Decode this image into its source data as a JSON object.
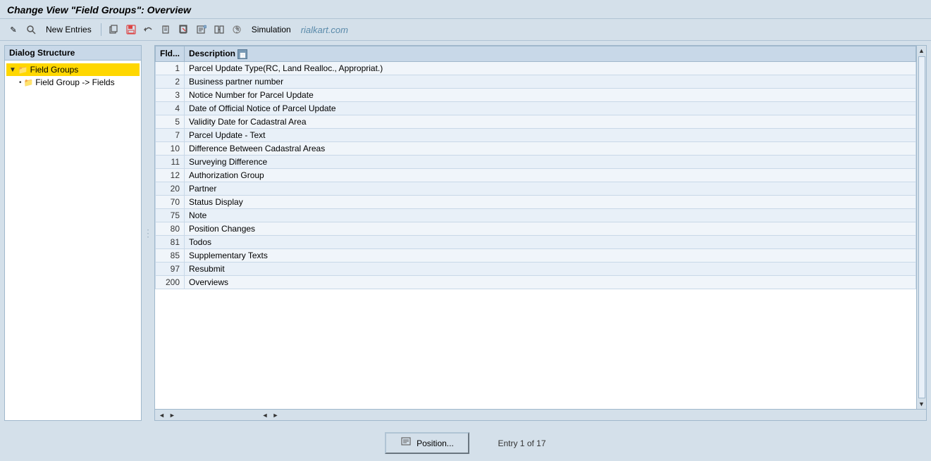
{
  "title": "Change View \"Field Groups\": Overview",
  "toolbar": {
    "buttons": [
      {
        "name": "other-icon",
        "icon": "✎",
        "label": "Other"
      },
      {
        "name": "find-icon",
        "icon": "🔍",
        "label": "Find"
      },
      {
        "name": "new-entries-btn",
        "label": "New Entries"
      },
      {
        "name": "copy-icon",
        "icon": "📋",
        "label": "Copy"
      },
      {
        "name": "save-icon",
        "icon": "💾",
        "label": "Save"
      },
      {
        "name": "undo-icon",
        "icon": "↩",
        "label": "Undo"
      },
      {
        "name": "paste-icon",
        "icon": "📄",
        "label": "Paste"
      },
      {
        "name": "delete-icon",
        "icon": "🗑",
        "label": "Delete"
      },
      {
        "name": "detail-icon",
        "icon": "📑",
        "label": "Detail"
      },
      {
        "name": "simulation-btn",
        "label": "Simulation"
      }
    ],
    "watermark": "rialkart.com"
  },
  "left_panel": {
    "header": "Dialog Structure",
    "tree": [
      {
        "id": "field-groups",
        "label": "Field Groups",
        "level": 1,
        "arrow": "▼",
        "selected": true,
        "icon": "📁"
      },
      {
        "id": "field-group-fields",
        "label": "Field Group -> Fields",
        "level": 2,
        "arrow": "•",
        "selected": false,
        "icon": "📁"
      }
    ]
  },
  "right_panel": {
    "columns": [
      {
        "key": "fld",
        "label": "Fld..."
      },
      {
        "key": "description",
        "label": "Description"
      }
    ],
    "rows": [
      {
        "fld": "1",
        "description": "Parcel Update Type(RC, Land Realloc., Appropriat.)"
      },
      {
        "fld": "2",
        "description": "Business partner number"
      },
      {
        "fld": "3",
        "description": "Notice Number for Parcel Update"
      },
      {
        "fld": "4",
        "description": "Date of Official Notice of Parcel Update"
      },
      {
        "fld": "5",
        "description": "Validity Date for Cadastral Area"
      },
      {
        "fld": "7",
        "description": "Parcel Update - Text"
      },
      {
        "fld": "10",
        "description": "Difference Between Cadastral Areas"
      },
      {
        "fld": "11",
        "description": "Surveying Difference"
      },
      {
        "fld": "12",
        "description": "Authorization Group"
      },
      {
        "fld": "20",
        "description": "Partner"
      },
      {
        "fld": "70",
        "description": "Status Display"
      },
      {
        "fld": "75",
        "description": "Note"
      },
      {
        "fld": "80",
        "description": "Position Changes"
      },
      {
        "fld": "81",
        "description": "Todos"
      },
      {
        "fld": "85",
        "description": "Supplementary Texts"
      },
      {
        "fld": "97",
        "description": "Resubmit"
      },
      {
        "fld": "200",
        "description": "Overviews"
      }
    ]
  },
  "bottom": {
    "position_btn_label": "Position...",
    "entry_info": "Entry 1 of 17"
  }
}
